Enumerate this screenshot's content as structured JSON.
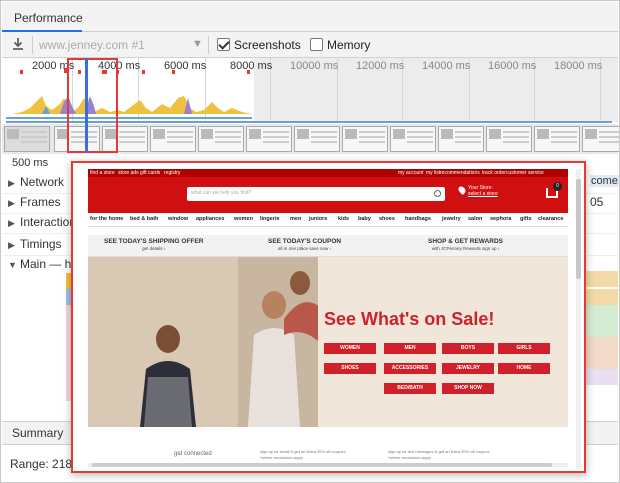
{
  "tabbar": {
    "tab_label": "Performance"
  },
  "toolbar": {
    "profile_select": "www.jenney.com #1",
    "screenshots_label": "Screenshots",
    "screenshots_checked": true,
    "memory_label": "Memory",
    "memory_checked": false
  },
  "overview": {
    "ticks": [
      "2000 ms",
      "4000 ms",
      "6000 ms",
      "8000 ms",
      "10000 ms",
      "12000 ms",
      "14000 ms",
      "16000 ms",
      "18000 ms"
    ]
  },
  "ruler": {
    "start_label": "500 ms",
    "right_partial": "come."
  },
  "tracks": {
    "network": "Network",
    "frames": "Frames",
    "interactions": "Interactions",
    "timings": "Timings",
    "main": "Main — htt",
    "frames_value": "05"
  },
  "summary": {
    "tab": "Summary",
    "range": "Range: 218"
  },
  "preview": {
    "top_links": [
      "find a store",
      "store ads",
      "gift cards",
      "registry"
    ],
    "top_right_links": [
      "my account",
      "my list",
      "recommendations",
      "track order",
      "customer service",
      "accessible view"
    ],
    "search_placeholder": "what can we help you find?",
    "store_label": "Your Store:",
    "store_link": "select a store",
    "cart_count": "0",
    "nav": [
      "for the home",
      "bed & bath",
      "window",
      "appliances",
      "women",
      "lingerie",
      "men",
      "juniors",
      "kids",
      "baby",
      "shoes",
      "handbags",
      "jewelry",
      "salon",
      "sephora",
      "gifts",
      "clearance"
    ],
    "promos": [
      {
        "title": "SEE TODAY'S SHIPPING OFFER",
        "sub": "get details ›"
      },
      {
        "title": "SEE TODAY'S COUPON",
        "sub": "all in one place save now ›"
      },
      {
        "title": "SHOP & GET REWARDS",
        "sub": "with JCPenney Rewards sign up ›"
      }
    ],
    "hero_title": "See What's on Sale!",
    "hero_buttons": [
      "WOMEN",
      "MEN",
      "BOYS",
      "GIRLS",
      "SHOES",
      "ACCESSORIES",
      "JEWELRY",
      "HOME",
      "BED/BATH",
      "SHOP NOW"
    ],
    "foot_heading": "get connected",
    "foot_text_1": "sign up for email & get an Extra 20% off coupon!",
    "foot_text_1b": "*where exclusions apply",
    "foot_text_2": "sign up for text messages & get an Extra 20% off coupon!",
    "foot_text_2b": "*where exclusions apply"
  },
  "colors": {
    "accent_red": "#e53935",
    "jcp_red": "#d01010",
    "tab_blue": "#1a73e8"
  }
}
